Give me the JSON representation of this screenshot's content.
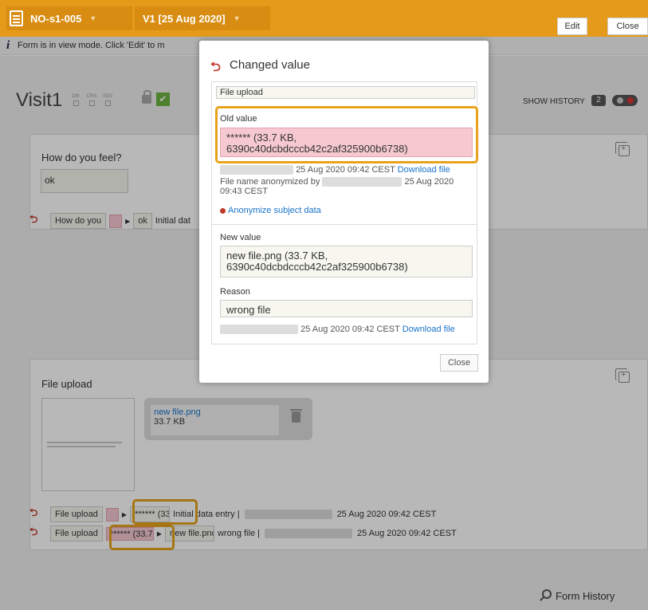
{
  "topbar": {
    "form_name": "NO-s1-005",
    "visit_name": "V1 [25 Aug 2020]",
    "edit_label": "Edit",
    "close_label": "Close"
  },
  "info_bar": {
    "text": "Form is in view mode. Click 'Edit' to m"
  },
  "visit": {
    "title": "Visit1",
    "flags": [
      "DM",
      "CRA",
      "SDV"
    ],
    "show_history_label": "SHOW HISTORY",
    "history_count": "2"
  },
  "question1": {
    "label": "How do you feel?",
    "value": "ok",
    "history_field": "How do you",
    "history_value": "ok",
    "history_note": "Initial dat"
  },
  "question2": {
    "label": "File upload",
    "file_name": "new file.png",
    "file_size": "33.7 KB",
    "history": [
      {
        "field": "File upload",
        "old": "",
        "new": "****** (33.7",
        "note": "Initial data entry |",
        "date": "25 Aug 2020 09:42 CEST"
      },
      {
        "field": "File upload",
        "old": "****** (33.7",
        "new": "new file.pnç",
        "note": "wrong file |",
        "date": "25 Aug 2020 09:42 CEST"
      }
    ]
  },
  "modal": {
    "title": "Changed value",
    "field_name": "File upload",
    "old_value_label": "Old value",
    "old_value": "****** (33.7 KB, 6390c40dcbdcccb42c2af325900b6738)",
    "old_meta_date": "25 Aug 2020 09:42 CEST",
    "download_label": "Download file",
    "anonymized_by_label": "File name anonymized by",
    "anonymized_date": "25 Aug 2020",
    "anonymized_time": "09:43 CEST",
    "anonymize_link": "Anonymize subject data",
    "new_value_label": "New value",
    "new_value": "new file.png (33.7 KB, 6390c40dcbdcccb42c2af325900b6738)",
    "reason_label": "Reason",
    "reason_value": "wrong file",
    "new_meta_date": "25 Aug 2020 09:42 CEST",
    "close_label": "Close"
  },
  "footer": {
    "form_history_label": "Form History"
  },
  "colors": {
    "topbar": "#e59a1a",
    "highlight": "#e8a21c",
    "old_value_bg": "#f6c9d1",
    "link": "#1a73c8"
  }
}
